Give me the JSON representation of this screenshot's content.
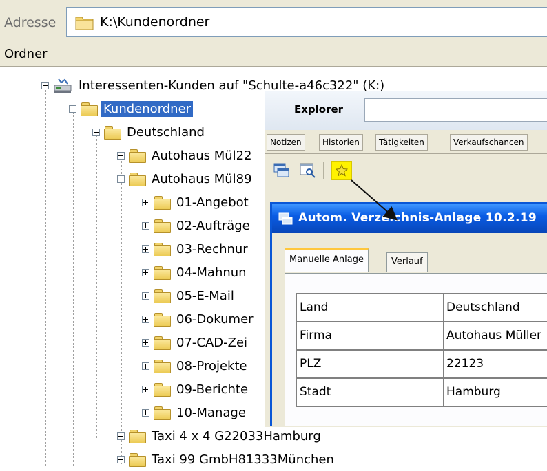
{
  "address": {
    "label": "Adresse",
    "value": "K:\\Kundenordner"
  },
  "folder_pane": {
    "header": "Ordner"
  },
  "tree": {
    "root": "Interessenten-Kunden auf \"Schulte-a46c322\" (K:)",
    "kundenordner": "Kundenordner",
    "deutschland": "Deutschland",
    "autohaus_1": "Autohaus Mül22",
    "autohaus_2": "Autohaus Mül89",
    "subfolders": [
      "01-Angebot",
      "02-Aufträge",
      "03-Rechnur",
      "04-Mahnun",
      "05-E-Mail",
      "06-Dokumer",
      "07-CAD-Zei",
      "08-Projekte",
      "09-Berichte",
      "10-Manage"
    ],
    "taxi_1": "Taxi 4 x 4 G22033Hamburg",
    "taxi_2": "Taxi 99 GmbH81333München"
  },
  "crm": {
    "title": "Explorer",
    "tabs": [
      "Notizen",
      "Historien",
      "Tätigkeiten",
      "Verkaufschancen"
    ],
    "toolbar_icons": [
      "windows-icon",
      "search-window-icon",
      "star-icon"
    ]
  },
  "dialog": {
    "title": "Autom. Verzeichnis-Anlage 10.2.19",
    "tabs": [
      "Manuelle Anlage",
      "Verlauf"
    ],
    "rows": [
      {
        "key": "Land",
        "value": "Deutschland"
      },
      {
        "key": "Firma",
        "value": "Autohaus Müller"
      },
      {
        "key": "PLZ",
        "value": "22123"
      },
      {
        "key": "Stadt",
        "value": "Hamburg"
      }
    ]
  },
  "colors": {
    "selection": "#316ac5",
    "dialog_title": "#0a5ce4",
    "highlight": "#fff200"
  }
}
